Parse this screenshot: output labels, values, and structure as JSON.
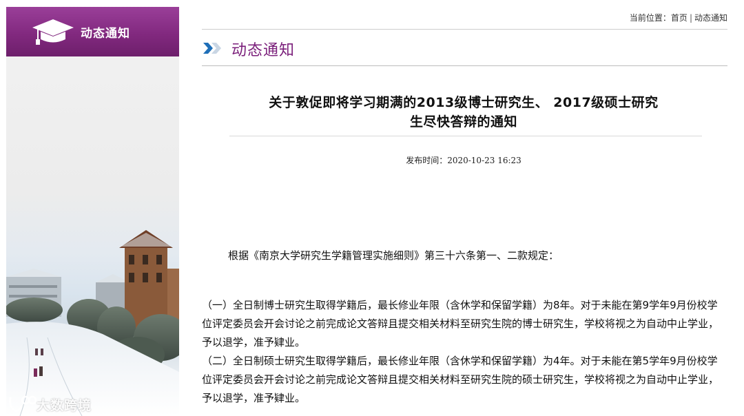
{
  "sidebar": {
    "title": "动态通知",
    "watermark": "大数跨境"
  },
  "breadcrumb": {
    "prefix": "当前位置：",
    "home": "首页",
    "separator": "|",
    "current": "动态通知"
  },
  "section": {
    "title": "动态通知"
  },
  "article": {
    "title_line1": "关于敦促即将学习期满的2013级博士研究生、 2017级硕士研究",
    "title_line2": "生尽快答辩的通知",
    "pubtime": "发布时间：2020-10-23 16:23",
    "intro": "根据《南京大学研究生学籍管理实施细则》第三十六条第一、二款规定：",
    "clause1": "（一）全日制博士研究生取得学籍后，最长修业年限（含休学和保留学籍）为8年。对于未能在第9学年9月份校学位评定委员会开会讨论之前完成论文答辩且提交相关材料至研究生院的博士研究生，学校将视之为自动中止学业，予以退学，准予肄业。",
    "clause2": "（二）全日制硕士研究生取得学籍后，最长修业年限（含休学和保留学籍）为4年。对于未能在第5学年9月份校学位评定委员会开会讨论之前完成论文答辩且提交相关材料至研究生院的硕士研究生，学校将视之为自动中止学业，予以退学，准予肄业。"
  },
  "colors": {
    "brand_purple": "#82297f",
    "section_title": "#7a1e7a",
    "chevron_blue": "#1f6fb8"
  },
  "icons": [
    "graduation-cap-icon",
    "double-chevron-icon",
    "watermark-logo-icon"
  ]
}
